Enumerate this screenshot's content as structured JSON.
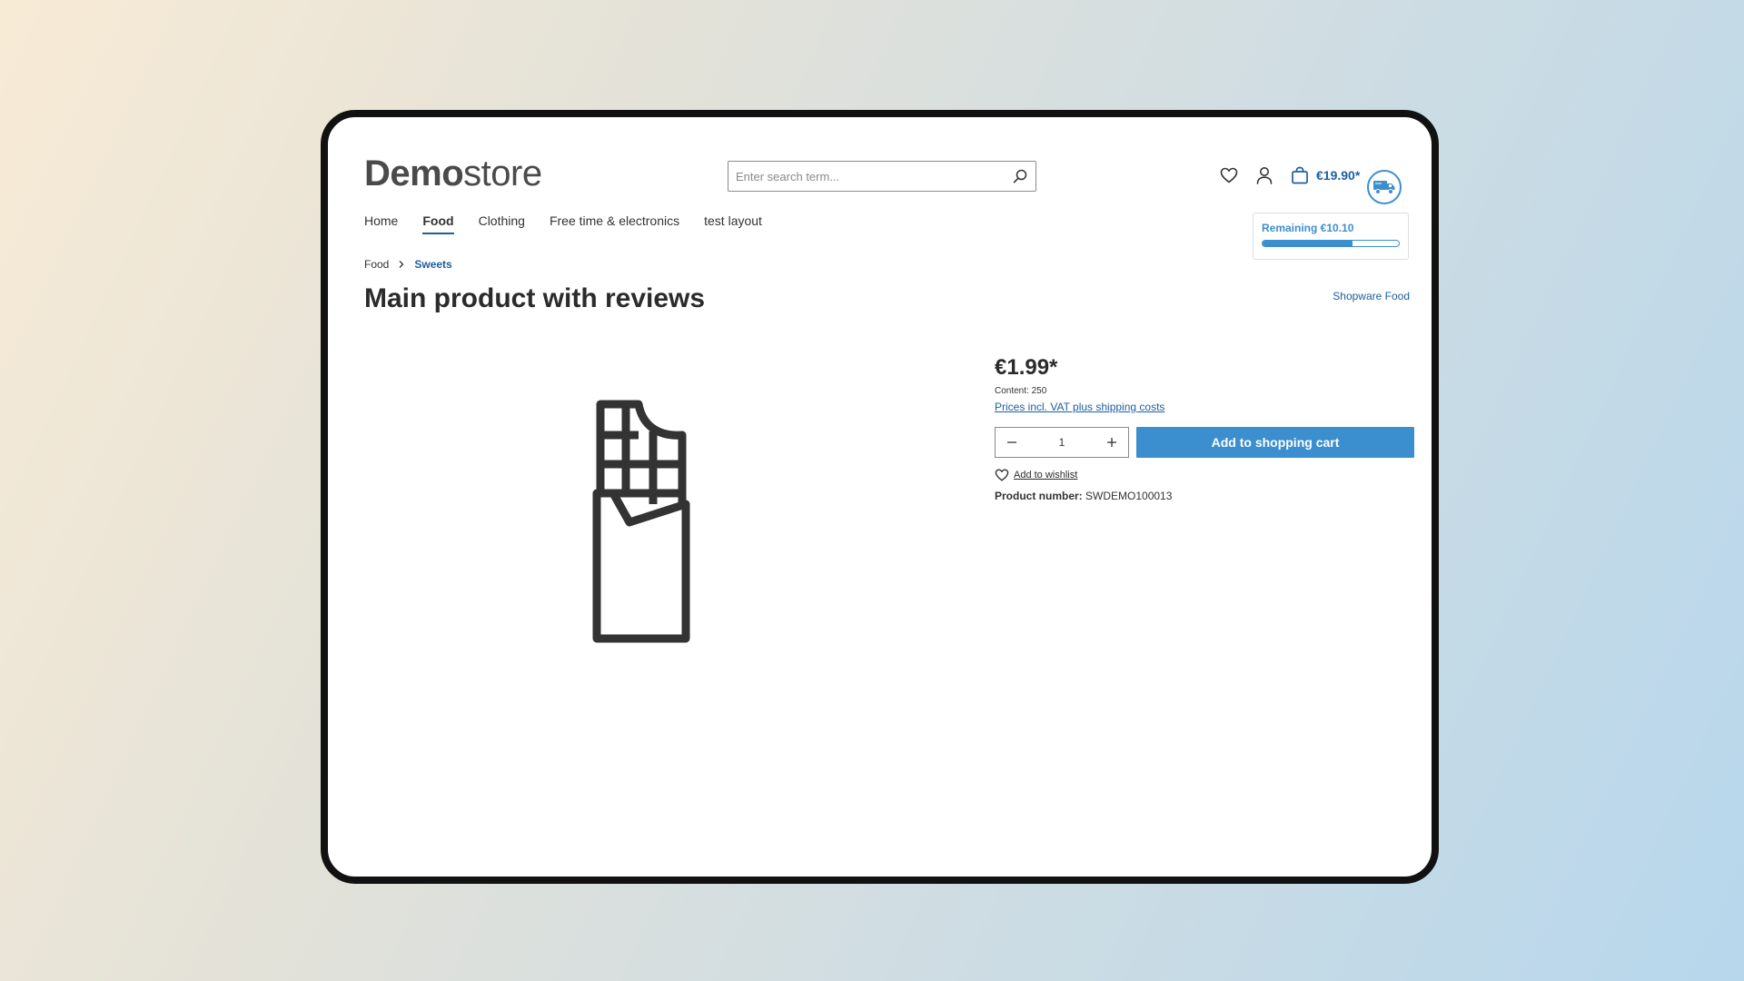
{
  "header": {
    "logo_bold": "Demo",
    "logo_light": "store",
    "search_placeholder": "Enter search term...",
    "cart_total": "€19.90*",
    "remaining_label": "Remaining €10.10",
    "remaining_progress": 0.66
  },
  "nav": {
    "items": [
      {
        "label": "Home"
      },
      {
        "label": "Food"
      },
      {
        "label": "Clothing"
      },
      {
        "label": "Free time & electronics"
      },
      {
        "label": "test layout"
      }
    ]
  },
  "breadcrumb": {
    "items": [
      "Food",
      "Sweets"
    ]
  },
  "product": {
    "title": "Main product with reviews",
    "manufacturer": "Shopware Food",
    "price": "€1.99*",
    "content": "Content: 250",
    "vat_link": "Prices incl. VAT plus shipping costs",
    "quantity": "1",
    "add_to_cart": "Add to shopping cart",
    "wishlist": "Add to wishlist",
    "product_number_label": "Product number:",
    "product_number": "SWDEMO100013",
    "image_icon": "chocolate-bar-icon"
  },
  "colors": {
    "accent": "#3c8fce",
    "link": "#1d5fa0",
    "text": "#2b2b2b"
  }
}
